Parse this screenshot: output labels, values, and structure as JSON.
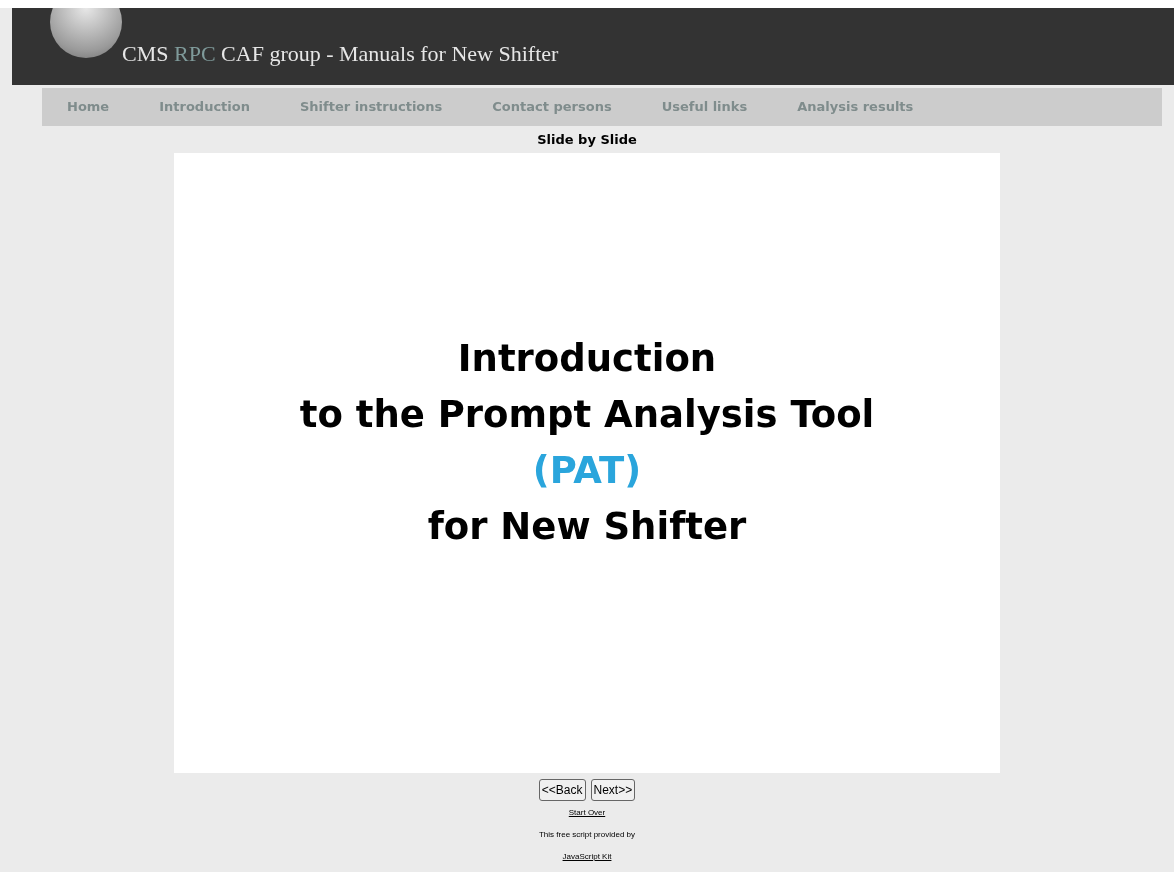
{
  "header": {
    "title": {
      "prefix": "CMS",
      "highlight": "RPC",
      "suffix": "CAF group - Manuals for New Shifter"
    }
  },
  "nav": [
    "Home",
    "Introduction",
    "Shifter instructions",
    "Contact persons",
    "Useful links",
    "Analysis results"
  ],
  "slideshow": {
    "caption": "Slide by Slide",
    "slide_lines": [
      {
        "text": "Introduction",
        "kind": "plain"
      },
      {
        "text": "to the Prompt Analysis Tool",
        "kind": "plain"
      },
      {
        "text": "(PAT)",
        "kind": "accent"
      },
      {
        "text": "for New Shifter",
        "kind": "plain"
      }
    ],
    "buttons": [
      "<<Back",
      "Next>>"
    ],
    "start_over": "Start Over",
    "credit": "This free script provided by",
    "credit_link": "JavaScript Kit"
  }
}
